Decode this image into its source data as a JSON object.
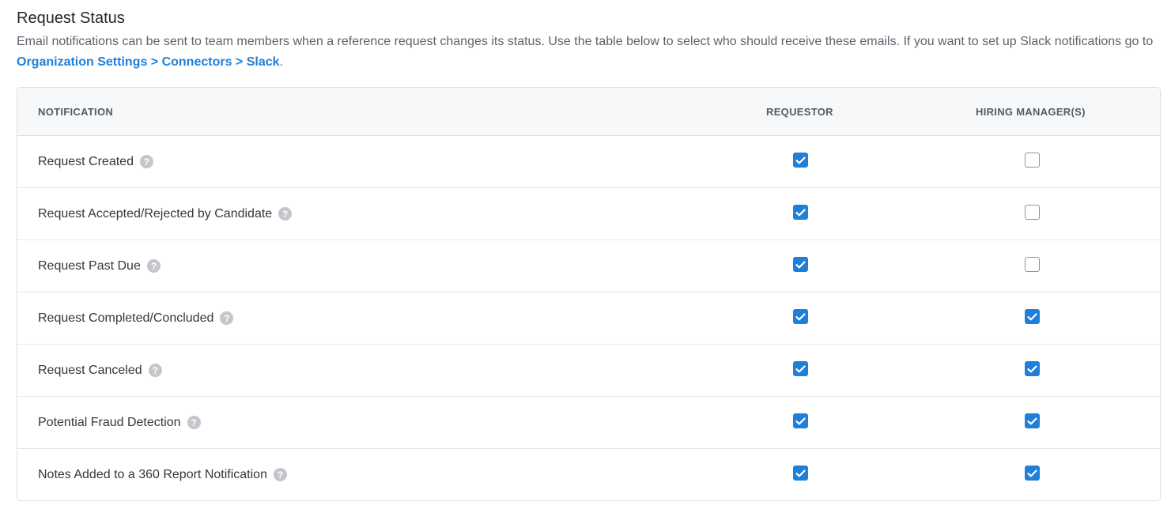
{
  "section": {
    "title": "Request Status",
    "description_pre": "Email notifications can be sent to team members when a reference request changes its status. Use the table below to select who should receive these emails. If you want to set up Slack notifications go to ",
    "link_text": "Organization Settings > Connectors > Slack",
    "description_post": "."
  },
  "table": {
    "headers": {
      "notification": "NOTIFICATION",
      "requestor": "REQUESTOR",
      "hiring_managers": "HIRING MANAGER(S)"
    },
    "rows": [
      {
        "label": "Request Created",
        "requestor": true,
        "hiring_manager": false
      },
      {
        "label": "Request Accepted/Rejected by Candidate",
        "requestor": true,
        "hiring_manager": false
      },
      {
        "label": "Request Past Due",
        "requestor": true,
        "hiring_manager": false
      },
      {
        "label": "Request Completed/Concluded",
        "requestor": true,
        "hiring_manager": true
      },
      {
        "label": "Request Canceled",
        "requestor": true,
        "hiring_manager": true
      },
      {
        "label": "Potential Fraud Detection",
        "requestor": true,
        "hiring_manager": true
      },
      {
        "label": "Notes Added to a 360 Report Notification",
        "requestor": true,
        "hiring_manager": true
      }
    ]
  },
  "icons": {
    "help": "question-circle-icon",
    "check": "checkmark-icon"
  },
  "colors": {
    "accent": "#1f7fd9",
    "link": "#1f80d8",
    "help_icon": "#c3c6cb"
  }
}
